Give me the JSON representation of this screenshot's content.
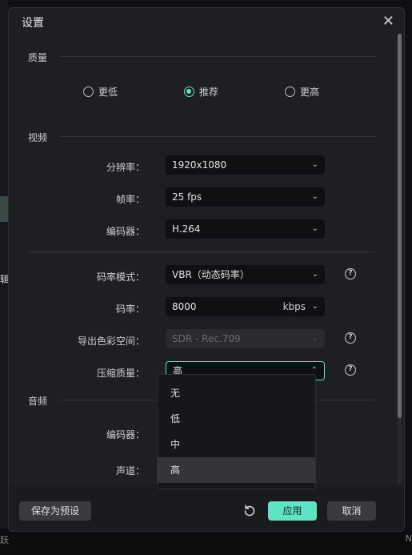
{
  "background": {
    "side_text": "辑",
    "bottom_left": "跃",
    "bottom_right": "N"
  },
  "dialog": {
    "title": "设置",
    "close_glyph": "✕"
  },
  "quality": {
    "section_label": "质量",
    "options": [
      {
        "label": "更低",
        "checked": false
      },
      {
        "label": "推荐",
        "checked": true
      },
      {
        "label": "更高",
        "checked": false
      }
    ]
  },
  "video": {
    "section_label": "视频",
    "resolution": {
      "label": "分辨率：",
      "value": "1920x1080"
    },
    "framerate": {
      "label": "帧率：",
      "value": "25 fps"
    },
    "encoder": {
      "label": "编码器：",
      "value": "H.264"
    },
    "bitrate_mode": {
      "label": "码率模式：",
      "value": "VBR（动态码率）"
    },
    "bitrate": {
      "label": "码率：",
      "value": "8000",
      "unit": "kbps"
    },
    "color_space": {
      "label": "导出色彩空间：",
      "value": "SDR - Rec.709",
      "disabled": true
    },
    "compression": {
      "label": "压缩质量：",
      "value": "高"
    }
  },
  "compression_dropdown": {
    "options": [
      "无",
      "低",
      "中",
      "高"
    ],
    "selected": "高"
  },
  "audio": {
    "section_label": "音频",
    "encoder": {
      "label": "编码器："
    },
    "channels": {
      "label": "声道："
    }
  },
  "footer": {
    "save_preset": "保存为预设",
    "apply": "应用",
    "cancel": "取消"
  },
  "colors": {
    "accent": "#5fe3c4",
    "panel": "#1e1f23",
    "field": "#0f1012"
  }
}
